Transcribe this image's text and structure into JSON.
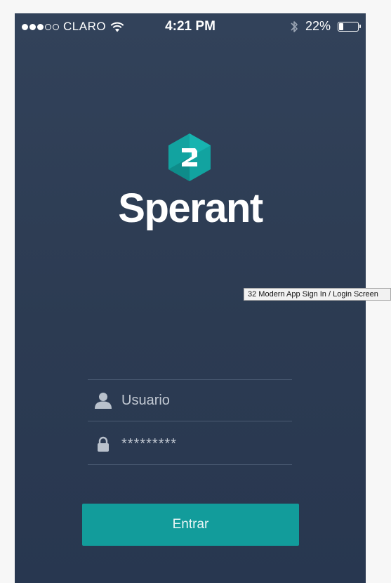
{
  "status_bar": {
    "signal_bars_filled": 3,
    "signal_bars_total": 5,
    "carrier": "CLARO",
    "time": "4:21 PM",
    "battery": "22%",
    "battery_level": 0.22
  },
  "brand": {
    "logo_icon": "sperant-hex-s-icon",
    "logo_color": "#12a3a0",
    "name": "Sperant"
  },
  "login": {
    "username_placeholder": "Usuario",
    "username_value": "",
    "password_mask": "*********",
    "submit_label": "Entrar"
  },
  "tooltip": {
    "text": "32 Modern App Sign In / Login Screen"
  },
  "colors": {
    "background_top": "#32425a",
    "background_bottom": "#283750",
    "accent": "#129c9b",
    "divider": "#4a5a72"
  }
}
